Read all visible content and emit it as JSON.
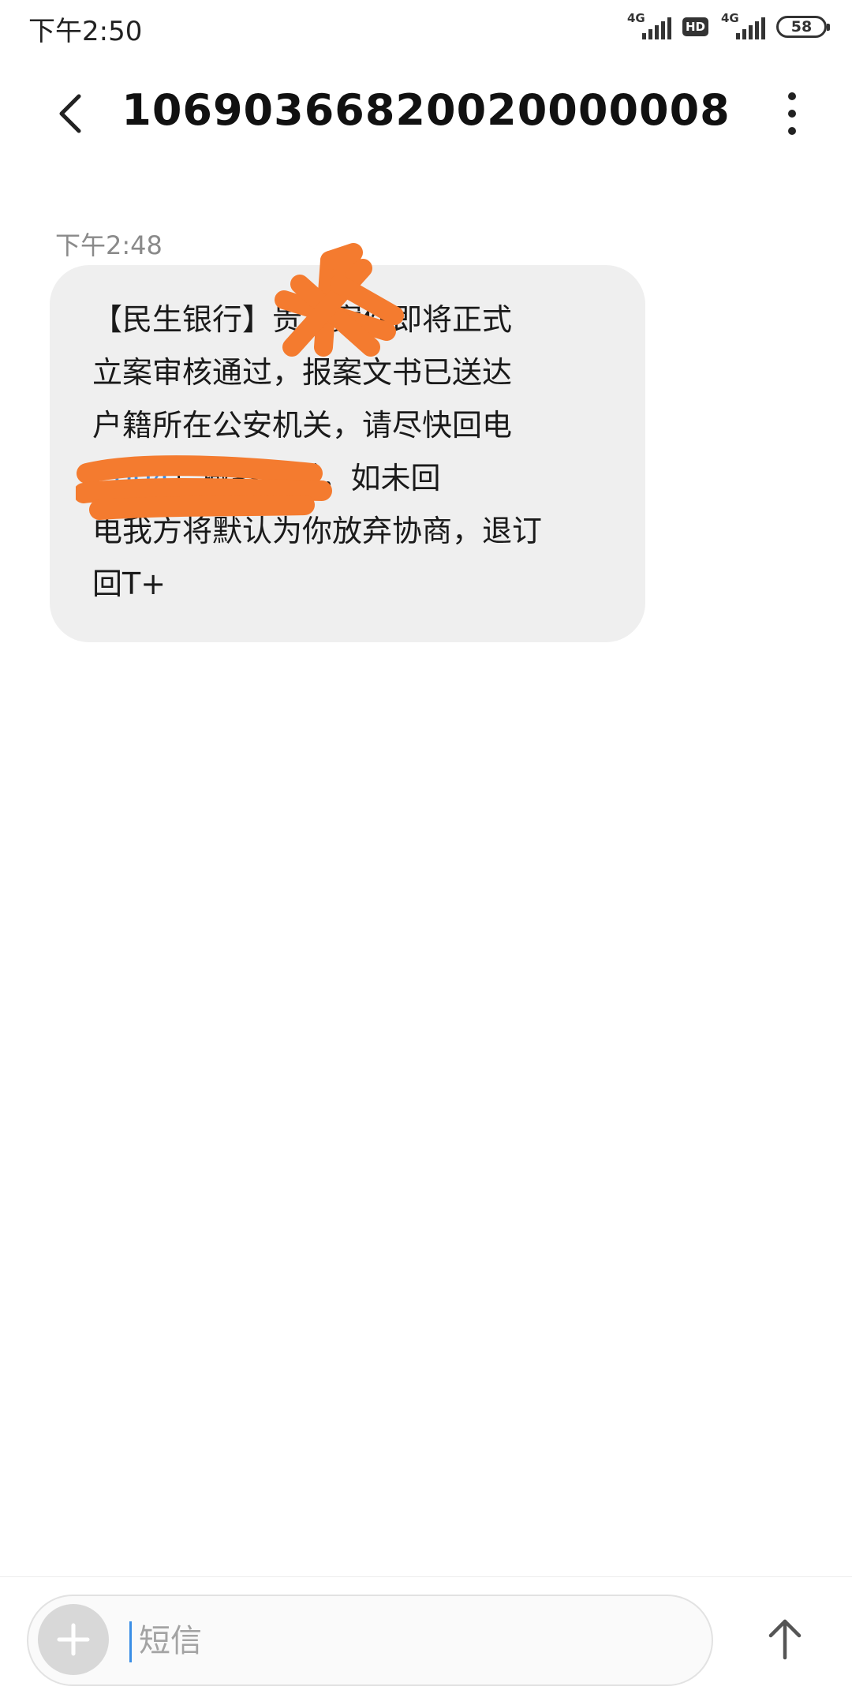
{
  "status_bar": {
    "time": "下午2:50",
    "signal1_label": "4G",
    "hd_label": "HD",
    "signal2_label": "4G",
    "battery": "58"
  },
  "header": {
    "title": "106903668200200000​08"
  },
  "conversation": {
    "timestamp": "下午2:48",
    "message_lines": [
      "【民生银行】贵方案件即将正式",
      "立案审核通过，报案文书已送达",
      "户籍所在公安机关，请尽快回电",
      "）撤案撤诉，如未回",
      "电我方将默认为你放弃协商，退订",
      "回T+"
    ],
    "link_fragment": "(   004",
    "redaction_color": "#F47B2F"
  },
  "composer": {
    "placeholder": "短信",
    "value": ""
  },
  "colors": {
    "accent": "#3a8ee6",
    "bubble": "#efefef",
    "redaction": "#F47B2F"
  }
}
